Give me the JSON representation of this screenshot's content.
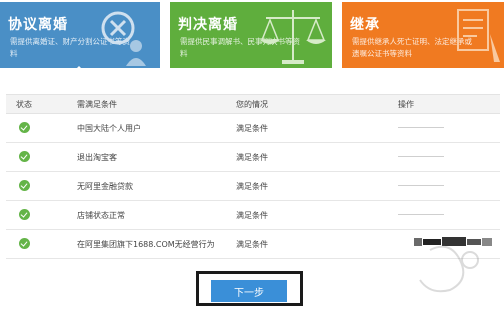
{
  "tiles": [
    {
      "title": "协议离婚",
      "desc": "需提供离婚证、财产分割公证书等资料",
      "color": "#4a8fc6",
      "icon": "close-icon"
    },
    {
      "title": "判决离婚",
      "desc": "需提供民事调解书、民事判决书等资料",
      "color": "#5fae3d",
      "icon": "scales-icon"
    },
    {
      "title": "继承",
      "desc": "需提供继承人死亡证明、法定继承或遗嘱公证书等资料",
      "color": "#f07a21",
      "icon": "will-icon"
    }
  ],
  "table": {
    "headers": {
      "status": "状态",
      "condition": "需满足条件",
      "yours": "您的情况",
      "operation": "操作"
    },
    "rows": [
      {
        "status": "check-icon",
        "condition": "中国大陆个人用户",
        "yours": "满足条件"
      },
      {
        "status": "check-icon",
        "condition": "退出淘宝客",
        "yours": "满足条件"
      },
      {
        "status": "check-icon",
        "condition": "无阿里金融贷款",
        "yours": "满足条件"
      },
      {
        "status": "check-icon",
        "condition": "店铺状态正常",
        "yours": "满足条件"
      },
      {
        "status": "check-icon",
        "condition": "在阿里集团旗下1688.COM无经营行为",
        "yours": "满足条件"
      }
    ]
  },
  "next_button": {
    "label": "下一步"
  },
  "colors": {
    "check": "#64b448",
    "button": "#3a8fd8"
  }
}
